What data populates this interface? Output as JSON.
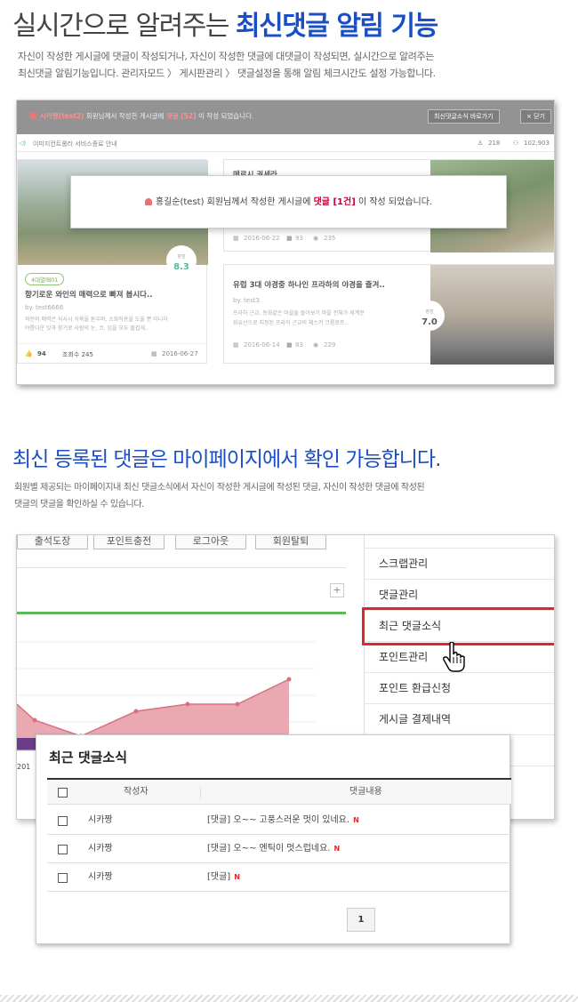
{
  "section1": {
    "title_prefix": "실시간으로 알려주는 ",
    "title_highlight": "최신댓글 알림 기능",
    "desc_line1": "자신이 작성한 게시글에 댓글이 작성되거나, 자신이 작성한 댓글에 대댓글이 작성되면, 실시간으로 알려주는",
    "desc_line2": "최신댓글 알림기능입니다. 관리자모드 〉 게시판관리 〉 댓글설정을 통해 알림 체크시간도 설정 가능합니다."
  },
  "screenshot1": {
    "topbar_user": "시카짱(test2)",
    "topbar_mid": " 회원님께서 작성한 게시글에 ",
    "topbar_count": "댓글 [52]",
    "topbar_tail": " 이 작성 되었습니다.",
    "btn_go": "최신댓글소식 바로가기",
    "btn_close": "× 닫기",
    "subbar_left": "이미지컨트롤러 서비스종료 안내",
    "subbar_stat1": "218",
    "subbar_stat2": "102,903",
    "popup_user": "홍길순(test)",
    "popup_mid": " 회원님께서 작성한 게시글에 ",
    "popup_count": "댓글 [1건]",
    "popup_tail": " 이 작성 되었습니다.",
    "card1": {
      "tag": "4대열매01",
      "title": "향기로운 와인의 매력으로 빠져 봅시다..",
      "author": "by. test6666",
      "text1": "와인의 매력은 식사시 식욕을 돋우며, 소화작용을 도울 뿐 아니라",
      "text2": "아름다운 맛과 향기로 사람의 눈, 코, 입을 모두 즐겁게..",
      "likes": "94",
      "views": "조회수 245",
      "date": "2016-06-27",
      "score_label": "평점",
      "score": "8.3"
    },
    "card2": {
      "title": "메르시 권세라",
      "date": "2016-06-22",
      "comments": "93",
      "views": "235"
    },
    "card3": {
      "title": "유럽 3대 야경중 하나인 프라하의 야경을 즐겨..",
      "author": "by. test3",
      "text1": "프라하 근교, 동화같은 마을들 돌아보기 마을 전체가 세계문",
      "text2": "화유산으로 지정된 프라하 근교의 체스키 크룸로프..",
      "date": "2016-06-14",
      "comments": "83",
      "views": "229",
      "score_label": "평점",
      "score": "7.0"
    }
  },
  "section2": {
    "title": "최신 등록된 댓글은 마이페이지에서 확인 가능합니다.",
    "desc_line1": "회원별 제공되는 마이페이지내 최신 댓글소식에서 자신이 작성한 게시글에 작성된 댓글, 자신이 작성한 댓글에 작성된",
    "desc_line2": "댓글의 댓글을 확인하실 수 있습니다."
  },
  "screenshot2": {
    "top_buttons": [
      "출석도장",
      "포인트충전",
      "로그아웃",
      "회원탈퇴"
    ],
    "menu": [
      "스크랩관리",
      "댓글관리",
      "최근 댓글소식",
      "포인트관리",
      "포인트 환급신청",
      "게시글 결제내역"
    ],
    "chart_label": "201",
    "plus": "+"
  },
  "panel": {
    "title": "최근 댓글소식",
    "col_author": "작성자",
    "col_content": "댓글내용",
    "rows": [
      {
        "author": "시카짱",
        "content": "[댓글] 오~~ 고풍스러운 멋이 있네요.",
        "new": "N"
      },
      {
        "author": "시카짱",
        "content": "[댓글] 오~~ 엔틱이 멋스럽네요.",
        "new": "N"
      },
      {
        "author": "시카짱",
        "content": "[댓글]",
        "new": "N"
      }
    ],
    "page": "1"
  },
  "colors": {
    "accent": "#1a4fc4",
    "highlight_red": "#e3262b",
    "comment_red": "#c8003a",
    "chart_green": "#5cb85c",
    "chart_pink": "#e8a0a8"
  },
  "icons": [
    "bell-icon",
    "speaker-icon",
    "person-icon",
    "view-icon",
    "calendar-icon",
    "comment-icon",
    "eye-icon",
    "thumb-icon",
    "hand-cursor-icon"
  ]
}
